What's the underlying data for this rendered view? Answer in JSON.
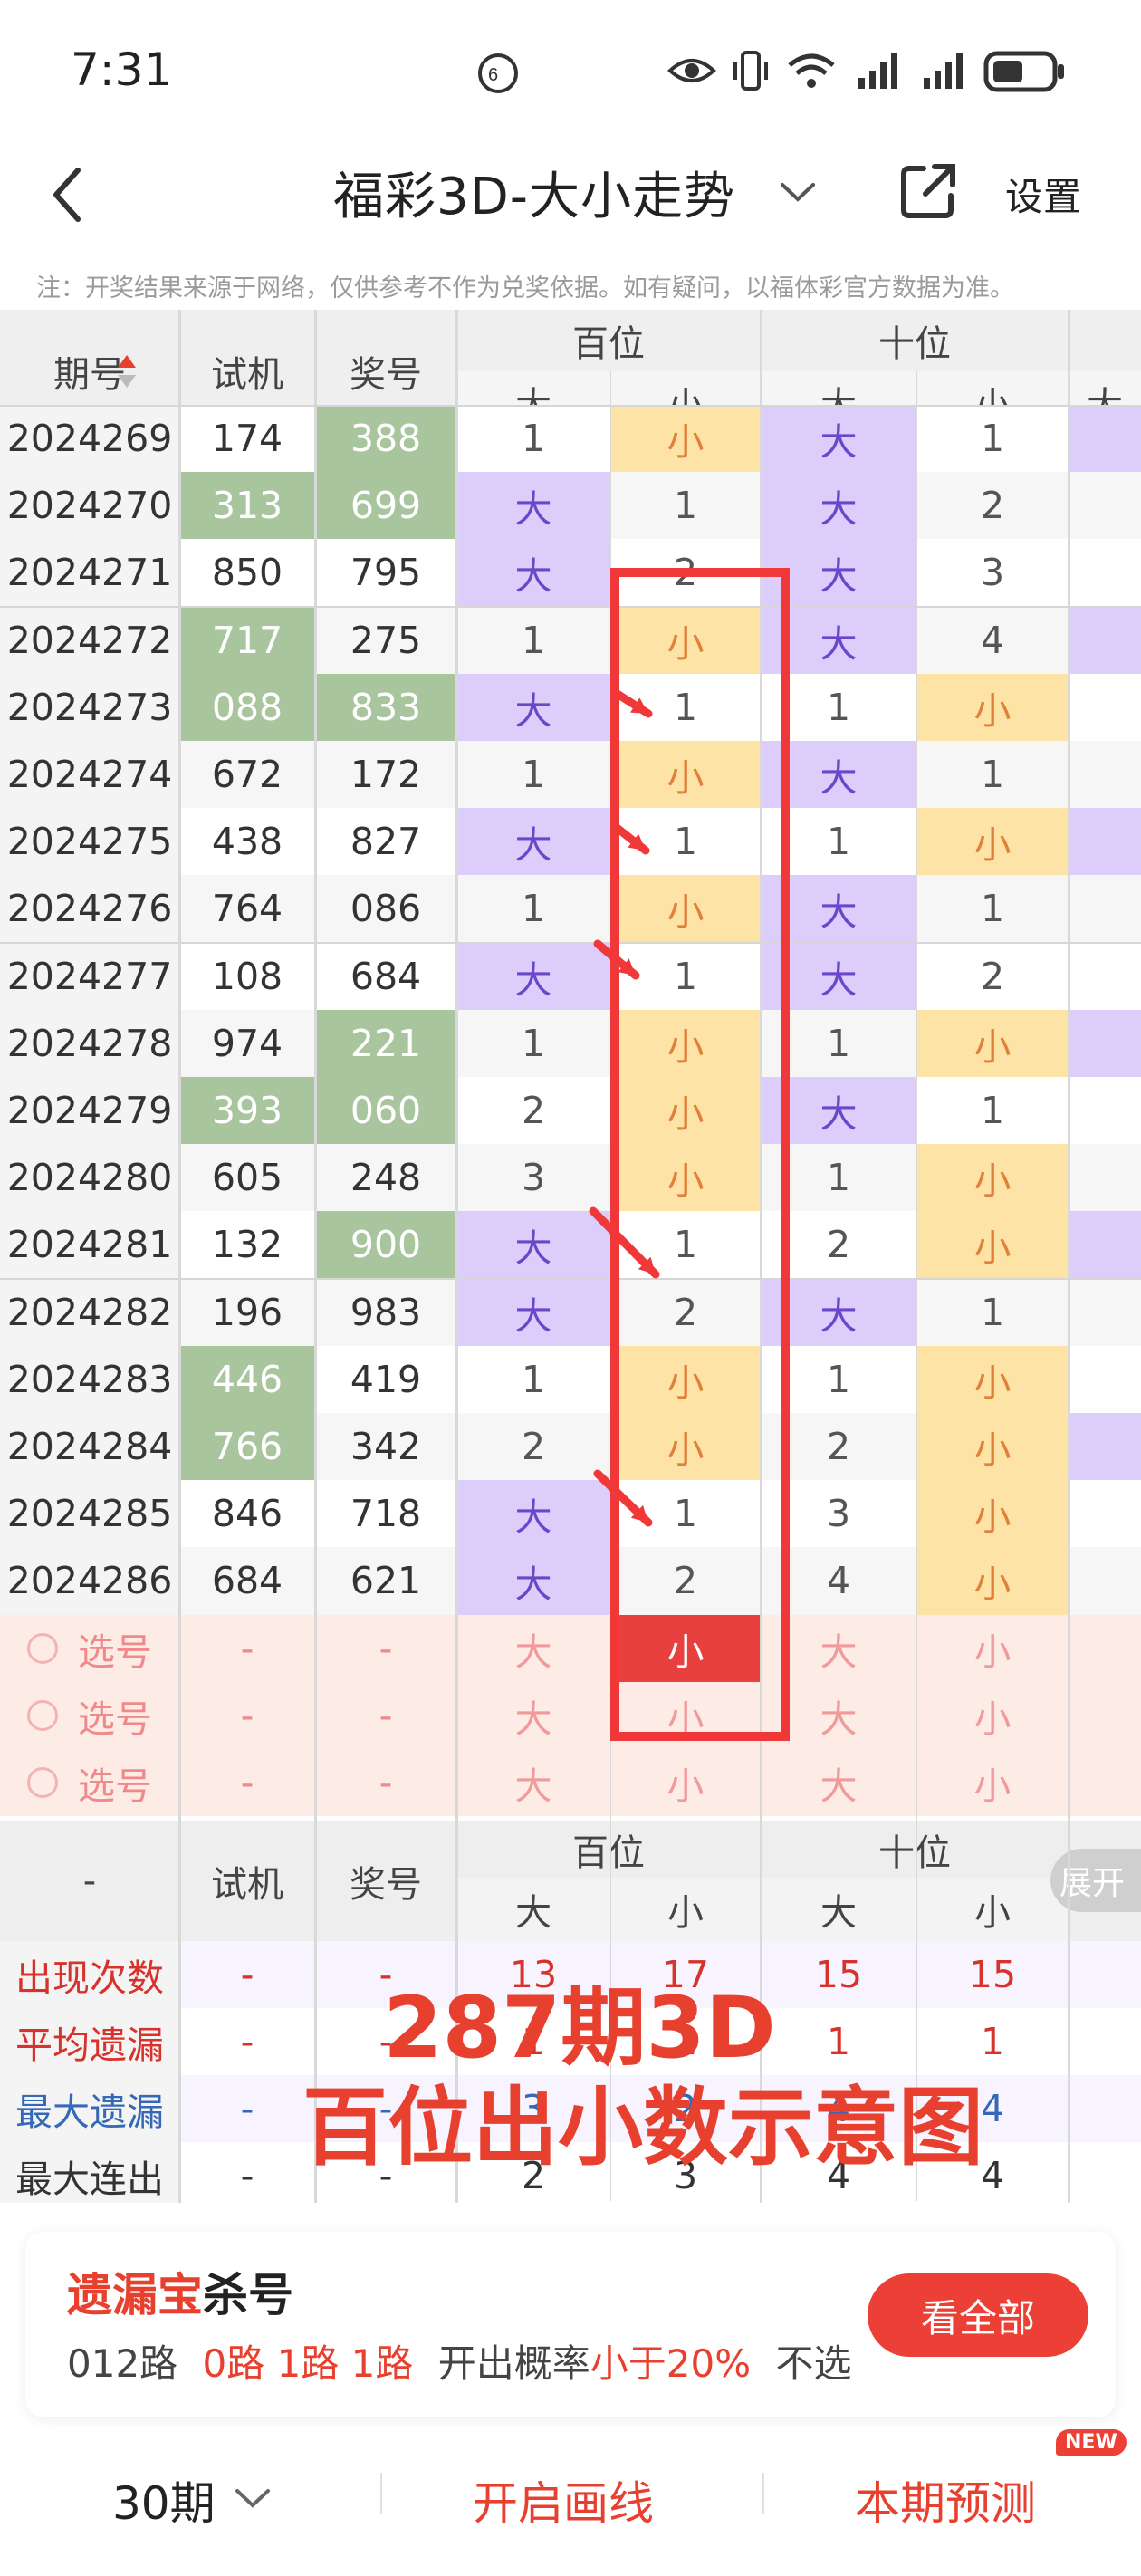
{
  "status_bar": {
    "time": "7:31"
  },
  "nav": {
    "title": "福彩3D-大小走势",
    "settings": "设置"
  },
  "notice": "注：开奖结果来源于网络，仅供参考不作为兑奖依据。如有疑问，以福体彩官方数据为准。",
  "table": {
    "headers": {
      "issue": "期号",
      "trial": "试机",
      "prize": "奖号",
      "hundreds": "百位",
      "tens": "十位",
      "big": "大",
      "small": "小"
    },
    "rows": [
      {
        "issue": "2024269",
        "trial": "174",
        "prize": "388",
        "h_big": "1",
        "h_small": "小",
        "t_big": "大",
        "t_small": "1",
        "trial_hl": false,
        "prize_hl": true
      },
      {
        "issue": "2024270",
        "trial": "313",
        "prize": "699",
        "h_big": "大",
        "h_small": "1",
        "t_big": "大",
        "t_small": "2",
        "trial_hl": true,
        "prize_hl": true
      },
      {
        "issue": "2024271",
        "trial": "850",
        "prize": "795",
        "h_big": "大",
        "h_small": "2",
        "t_big": "大",
        "t_small": "3",
        "trial_hl": false,
        "prize_hl": false
      },
      {
        "issue": "2024272",
        "trial": "717",
        "prize": "275",
        "h_big": "1",
        "h_small": "小",
        "t_big": "大",
        "t_small": "4",
        "trial_hl": true,
        "prize_hl": false
      },
      {
        "issue": "2024273",
        "trial": "088",
        "prize": "833",
        "h_big": "大",
        "h_small": "1",
        "t_big": "1",
        "t_small": "小",
        "trial_hl": true,
        "prize_hl": true
      },
      {
        "issue": "2024274",
        "trial": "672",
        "prize": "172",
        "h_big": "1",
        "h_small": "小",
        "t_big": "大",
        "t_small": "1",
        "trial_hl": false,
        "prize_hl": false
      },
      {
        "issue": "2024275",
        "trial": "438",
        "prize": "827",
        "h_big": "大",
        "h_small": "1",
        "t_big": "1",
        "t_small": "小",
        "trial_hl": false,
        "prize_hl": false
      },
      {
        "issue": "2024276",
        "trial": "764",
        "prize": "086",
        "h_big": "1",
        "h_small": "小",
        "t_big": "大",
        "t_small": "1",
        "trial_hl": false,
        "prize_hl": false
      },
      {
        "issue": "2024277",
        "trial": "108",
        "prize": "684",
        "h_big": "大",
        "h_small": "1",
        "t_big": "大",
        "t_small": "2",
        "trial_hl": false,
        "prize_hl": false
      },
      {
        "issue": "2024278",
        "trial": "974",
        "prize": "221",
        "h_big": "1",
        "h_small": "小",
        "t_big": "1",
        "t_small": "小",
        "trial_hl": false,
        "prize_hl": true
      },
      {
        "issue": "2024279",
        "trial": "393",
        "prize": "060",
        "h_big": "2",
        "h_small": "小",
        "t_big": "大",
        "t_small": "1",
        "trial_hl": true,
        "prize_hl": true
      },
      {
        "issue": "2024280",
        "trial": "605",
        "prize": "248",
        "h_big": "3",
        "h_small": "小",
        "t_big": "1",
        "t_small": "小",
        "trial_hl": false,
        "prize_hl": false
      },
      {
        "issue": "2024281",
        "trial": "132",
        "prize": "900",
        "h_big": "大",
        "h_small": "1",
        "t_big": "2",
        "t_small": "小",
        "trial_hl": false,
        "prize_hl": true
      },
      {
        "issue": "2024282",
        "trial": "196",
        "prize": "983",
        "h_big": "大",
        "h_small": "2",
        "t_big": "大",
        "t_small": "1",
        "trial_hl": false,
        "prize_hl": false
      },
      {
        "issue": "2024283",
        "trial": "446",
        "prize": "419",
        "h_big": "1",
        "h_small": "小",
        "t_big": "1",
        "t_small": "小",
        "trial_hl": true,
        "prize_hl": false
      },
      {
        "issue": "2024284",
        "trial": "766",
        "prize": "342",
        "h_big": "2",
        "h_small": "小",
        "t_big": "2",
        "t_small": "小",
        "trial_hl": true,
        "prize_hl": false
      },
      {
        "issue": "2024285",
        "trial": "846",
        "prize": "718",
        "h_big": "大",
        "h_small": "1",
        "t_big": "3",
        "t_small": "小",
        "trial_hl": false,
        "prize_hl": false
      },
      {
        "issue": "2024286",
        "trial": "684",
        "prize": "621",
        "h_big": "大",
        "h_small": "2",
        "t_big": "4",
        "t_small": "小",
        "trial_hl": false,
        "prize_hl": false
      }
    ],
    "pick_rows": [
      {
        "label": "选号",
        "trial": "-",
        "prize": "-",
        "h_big": "大",
        "h_small": "小",
        "t_big": "大",
        "t_small": "小",
        "selected": true
      },
      {
        "label": "选号",
        "trial": "-",
        "prize": "-",
        "h_big": "大",
        "h_small": "小",
        "t_big": "大",
        "t_small": "小",
        "selected": false
      },
      {
        "label": "选号",
        "trial": "-",
        "prize": "-",
        "h_big": "大",
        "h_small": "小",
        "t_big": "大",
        "t_small": "小",
        "selected": false
      }
    ],
    "stats_header": {
      "issue": "-",
      "trial": "试机",
      "prize": "奖号",
      "expand": "展开"
    },
    "stats": [
      {
        "label": "出现次数",
        "color": "#d8322c",
        "trial": "-",
        "prize": "-",
        "h_big": "13",
        "h_small": "17",
        "t_big": "15",
        "t_small": "15"
      },
      {
        "label": "平均遗漏",
        "color": "#d8322c",
        "trial": "-",
        "prize": "-",
        "h_big": "1",
        "h_small": "1",
        "t_big": "1",
        "t_small": "1"
      },
      {
        "label": "最大遗漏",
        "color": "#3569b8",
        "trial": "-",
        "prize": "-",
        "h_big": "3",
        "h_small": "2",
        "t_big": "4",
        "t_small": "4"
      },
      {
        "label": "最大连出",
        "color": "#333333",
        "trial": "-",
        "prize": "-",
        "h_big": "2",
        "h_small": "3",
        "t_big": "4",
        "t_small": "4"
      }
    ]
  },
  "overlay": {
    "line1": "287期3D",
    "line2": "百位出小数示意图"
  },
  "kill_card": {
    "brand": "遗漏宝",
    "title_suffix": "杀号",
    "routes_label": "012路",
    "routes": "0路 1路 1路",
    "prob_label": "开出概率",
    "prob_value": "小于20%",
    "exclude": "不选",
    "button": "看全部"
  },
  "bottom_bar": {
    "periods": "30期",
    "draw_lines": "开启画线",
    "forecast": "本期预测",
    "new_badge": "NEW"
  },
  "colors": {
    "green": "#a8c59e",
    "purple": "#dccdfb",
    "yellow": "#fde4a6",
    "pink_bg": "#fdebe5",
    "red": "#e8402f",
    "frame": "#f03838"
  }
}
